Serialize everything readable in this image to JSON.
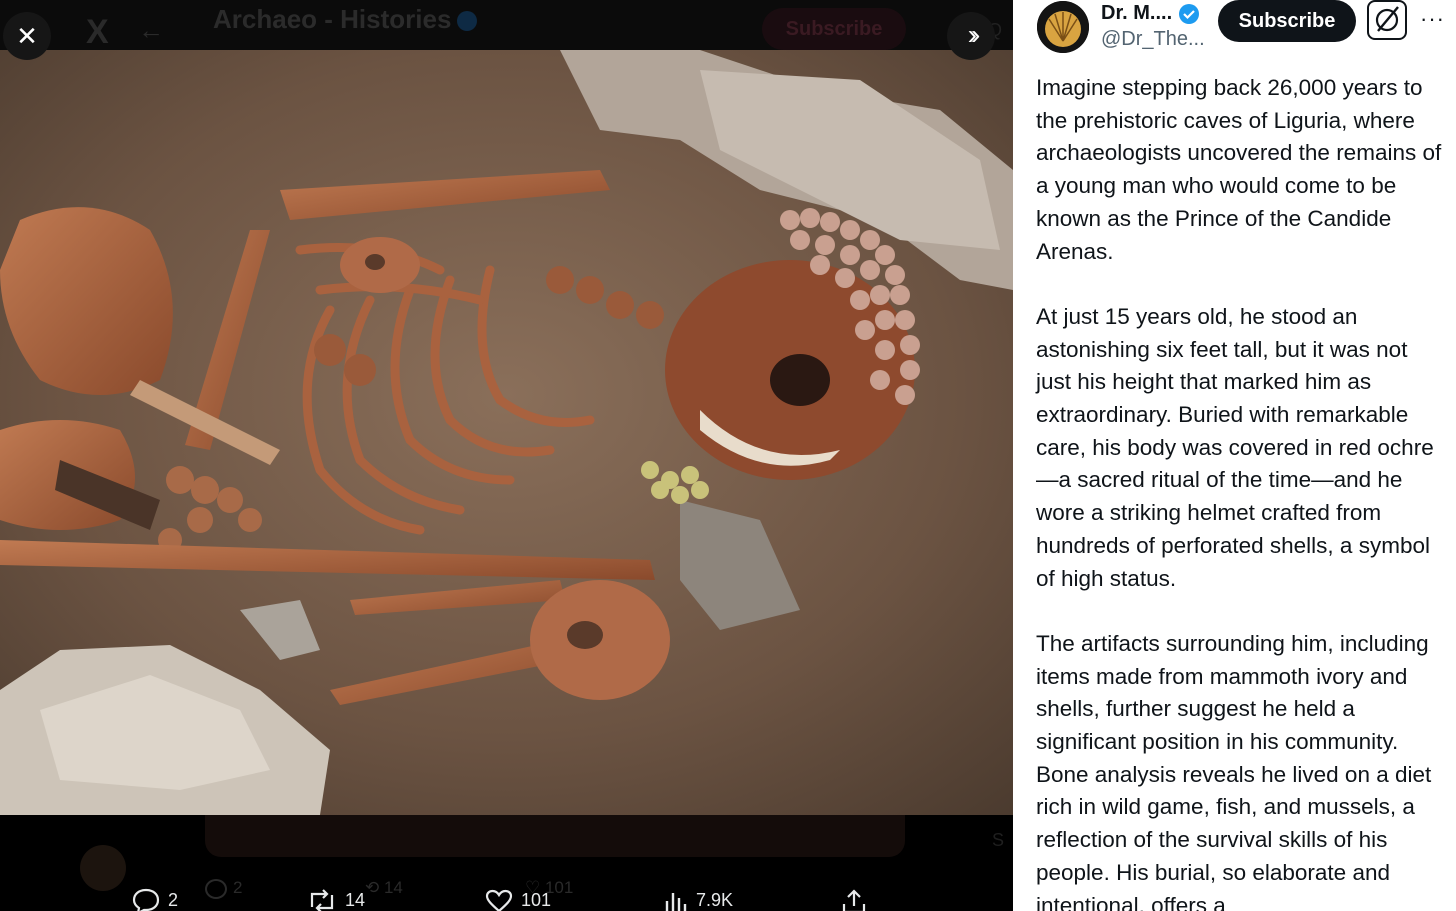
{
  "background": {
    "title": "Archaeo - Histories",
    "subscribe_label": "Subscribe",
    "ghost_counts": {
      "replies": "2",
      "reposts": "14",
      "likes": "101"
    }
  },
  "viewer": {
    "close_icon": "close-icon",
    "expand_icon": "double-chevron-right-icon"
  },
  "actions": {
    "replies": "2",
    "reposts": "14",
    "likes": "101",
    "views": "7.9K"
  },
  "post": {
    "author_name": "Dr. M....",
    "author_handle": "@Dr_The...",
    "subscribe_label": "Subscribe",
    "paragraphs": [
      "Imagine stepping back 26,000 years to the prehistoric caves of Liguria, where archaeologists uncovered the remains of a young man who would come to be known as the Prince of the Candide Arenas.",
      "At just 15 years old, he stood an astonishing six feet tall, but it was not just his height that marked him as extraordinary. Buried with remarkable care, his body was covered in red ochre—a sacred ritual of the time—and he wore a striking helmet crafted from hundreds of perforated shells, a symbol of high status.",
      "The artifacts surrounding him, including items made from mammoth ivory and shells, further suggest he held a significant position in his community. Bone analysis reveals he lived on a diet rich in wild game, fish, and mussels, a reflection of the survival skills of his people. His burial, so elaborate and intentional, offers a"
    ]
  },
  "colors": {
    "verified": "#1d9bf0",
    "text": "#0f1419",
    "muted": "#536471"
  }
}
